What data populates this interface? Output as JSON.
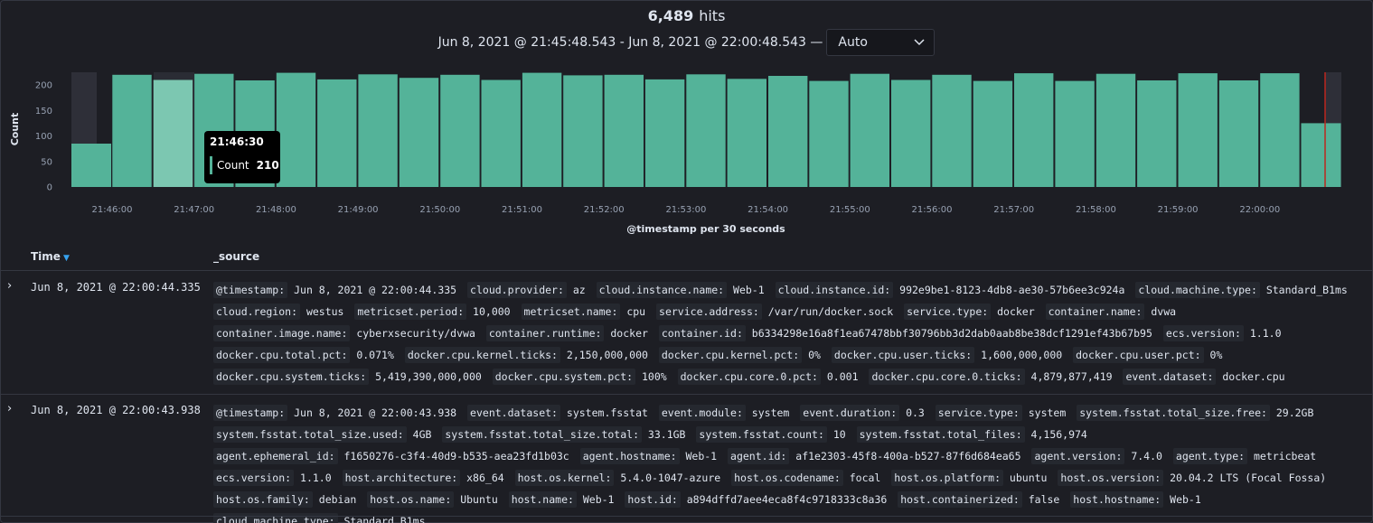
{
  "header": {
    "hits_count": "6,489",
    "hits_label": "hits",
    "time_range": "Jun 8, 2021 @ 21:45:48.543 - Jun 8, 2021 @ 22:00:48.543 —",
    "interval": "Auto"
  },
  "chart_data": {
    "type": "bar",
    "ylabel": "Count",
    "xlabel": "@timestamp per 30 seconds",
    "ylim": [
      0,
      225
    ],
    "y_ticks": [
      0,
      50,
      100,
      150,
      200
    ],
    "x_tick_labels": [
      "21:46:00",
      "21:47:00",
      "21:48:00",
      "21:49:00",
      "21:50:00",
      "21:51:00",
      "21:52:00",
      "21:53:00",
      "21:54:00",
      "21:55:00",
      "21:56:00",
      "21:57:00",
      "21:58:00",
      "21:59:00",
      "22:00:00"
    ],
    "categories": [
      "21:45:30",
      "21:46:00",
      "21:46:30",
      "21:47:00",
      "21:47:30",
      "21:48:00",
      "21:48:30",
      "21:49:00",
      "21:49:30",
      "21:50:00",
      "21:50:30",
      "21:51:00",
      "21:51:30",
      "21:52:00",
      "21:52:30",
      "21:53:00",
      "21:53:30",
      "21:54:00",
      "21:54:30",
      "21:55:00",
      "21:55:30",
      "21:56:00",
      "21:56:30",
      "21:57:00",
      "21:57:30",
      "21:58:00",
      "21:58:30",
      "21:59:00",
      "21:59:30",
      "22:00:00",
      "22:00:30"
    ],
    "values": [
      85,
      220,
      210,
      222,
      209,
      224,
      211,
      221,
      214,
      220,
      210,
      224,
      219,
      220,
      211,
      221,
      212,
      218,
      208,
      222,
      210,
      220,
      208,
      223,
      208,
      222,
      209,
      223,
      209,
      223,
      125
    ],
    "highlighted_index": 2,
    "grid": false
  },
  "tooltip": {
    "time": "21:46:30",
    "label": "Count",
    "value": "210"
  },
  "table": {
    "col_time": "Time",
    "col_source": "_source",
    "rows": [
      {
        "time": "Jun 8, 2021 @ 22:00:44.335",
        "fields": [
          [
            "@timestamp:",
            "Jun 8, 2021 @ 22:00:44.335"
          ],
          [
            "cloud.provider:",
            "az"
          ],
          [
            "cloud.instance.name:",
            "Web-1"
          ],
          [
            "cloud.instance.id:",
            "992e9be1-8123-4db8-ae30-57b6ee3c924a"
          ],
          [
            "cloud.machine.type:",
            "Standard_B1ms"
          ],
          [
            "cloud.region:",
            "westus"
          ],
          [
            "metricset.period:",
            "10,000"
          ],
          [
            "metricset.name:",
            "cpu"
          ],
          [
            "service.address:",
            "/var/run/docker.sock"
          ],
          [
            "service.type:",
            "docker"
          ],
          [
            "container.name:",
            "dvwa"
          ],
          [
            "container.image.name:",
            "cyberxsecurity/dvwa"
          ],
          [
            "container.runtime:",
            "docker"
          ],
          [
            "container.id:",
            "b6334298e16a8f1ea67478bbf30796bb3d2dab0aab8be38dcf1291ef43b67b95"
          ],
          [
            "ecs.version:",
            "1.1.0"
          ],
          [
            "docker.cpu.total.pct:",
            "0.071%"
          ],
          [
            "docker.cpu.kernel.ticks:",
            "2,150,000,000"
          ],
          [
            "docker.cpu.kernel.pct:",
            "0%"
          ],
          [
            "docker.cpu.user.ticks:",
            "1,600,000,000"
          ],
          [
            "docker.cpu.user.pct:",
            "0%"
          ],
          [
            "docker.cpu.system.ticks:",
            "5,419,390,000,000"
          ],
          [
            "docker.cpu.system.pct:",
            "100%"
          ],
          [
            "docker.cpu.core.0.pct:",
            "0.001"
          ],
          [
            "docker.cpu.core.0.ticks:",
            "4,879,877,419"
          ],
          [
            "event.dataset:",
            "docker.cpu"
          ]
        ]
      },
      {
        "time": "Jun 8, 2021 @ 22:00:43.938",
        "fields": [
          [
            "@timestamp:",
            "Jun 8, 2021 @ 22:00:43.938"
          ],
          [
            "event.dataset:",
            "system.fsstat"
          ],
          [
            "event.module:",
            "system"
          ],
          [
            "event.duration:",
            "0.3"
          ],
          [
            "service.type:",
            "system"
          ],
          [
            "system.fsstat.total_size.free:",
            "29.2GB"
          ],
          [
            "system.fsstat.total_size.used:",
            "4GB"
          ],
          [
            "system.fsstat.total_size.total:",
            "33.1GB"
          ],
          [
            "system.fsstat.count:",
            "10"
          ],
          [
            "system.fsstat.total_files:",
            "4,156,974"
          ],
          [
            "agent.ephemeral_id:",
            "f1650276-c3f4-40d9-b535-aea23fd1b03c"
          ],
          [
            "agent.hostname:",
            "Web-1"
          ],
          [
            "agent.id:",
            "af1e2303-45f8-400a-b527-87f6d684ea65"
          ],
          [
            "agent.version:",
            "7.4.0"
          ],
          [
            "agent.type:",
            "metricbeat"
          ],
          [
            "ecs.version:",
            "1.1.0"
          ],
          [
            "host.architecture:",
            "x86_64"
          ],
          [
            "host.os.kernel:",
            "5.4.0-1047-azure"
          ],
          [
            "host.os.codename:",
            "focal"
          ],
          [
            "host.os.platform:",
            "ubuntu"
          ],
          [
            "host.os.version:",
            "20.04.2 LTS (Focal Fossa)"
          ],
          [
            "host.os.family:",
            "debian"
          ],
          [
            "host.os.name:",
            "Ubuntu"
          ],
          [
            "host.name:",
            "Web-1"
          ],
          [
            "host.id:",
            "a894dffd7aee4eca8f4c9718333c8a36"
          ],
          [
            "host.containerized:",
            "false"
          ],
          [
            "host.hostname:",
            "Web-1"
          ],
          [
            "cloud.machine.type:",
            "Standard_B1ms"
          ]
        ]
      }
    ]
  }
}
